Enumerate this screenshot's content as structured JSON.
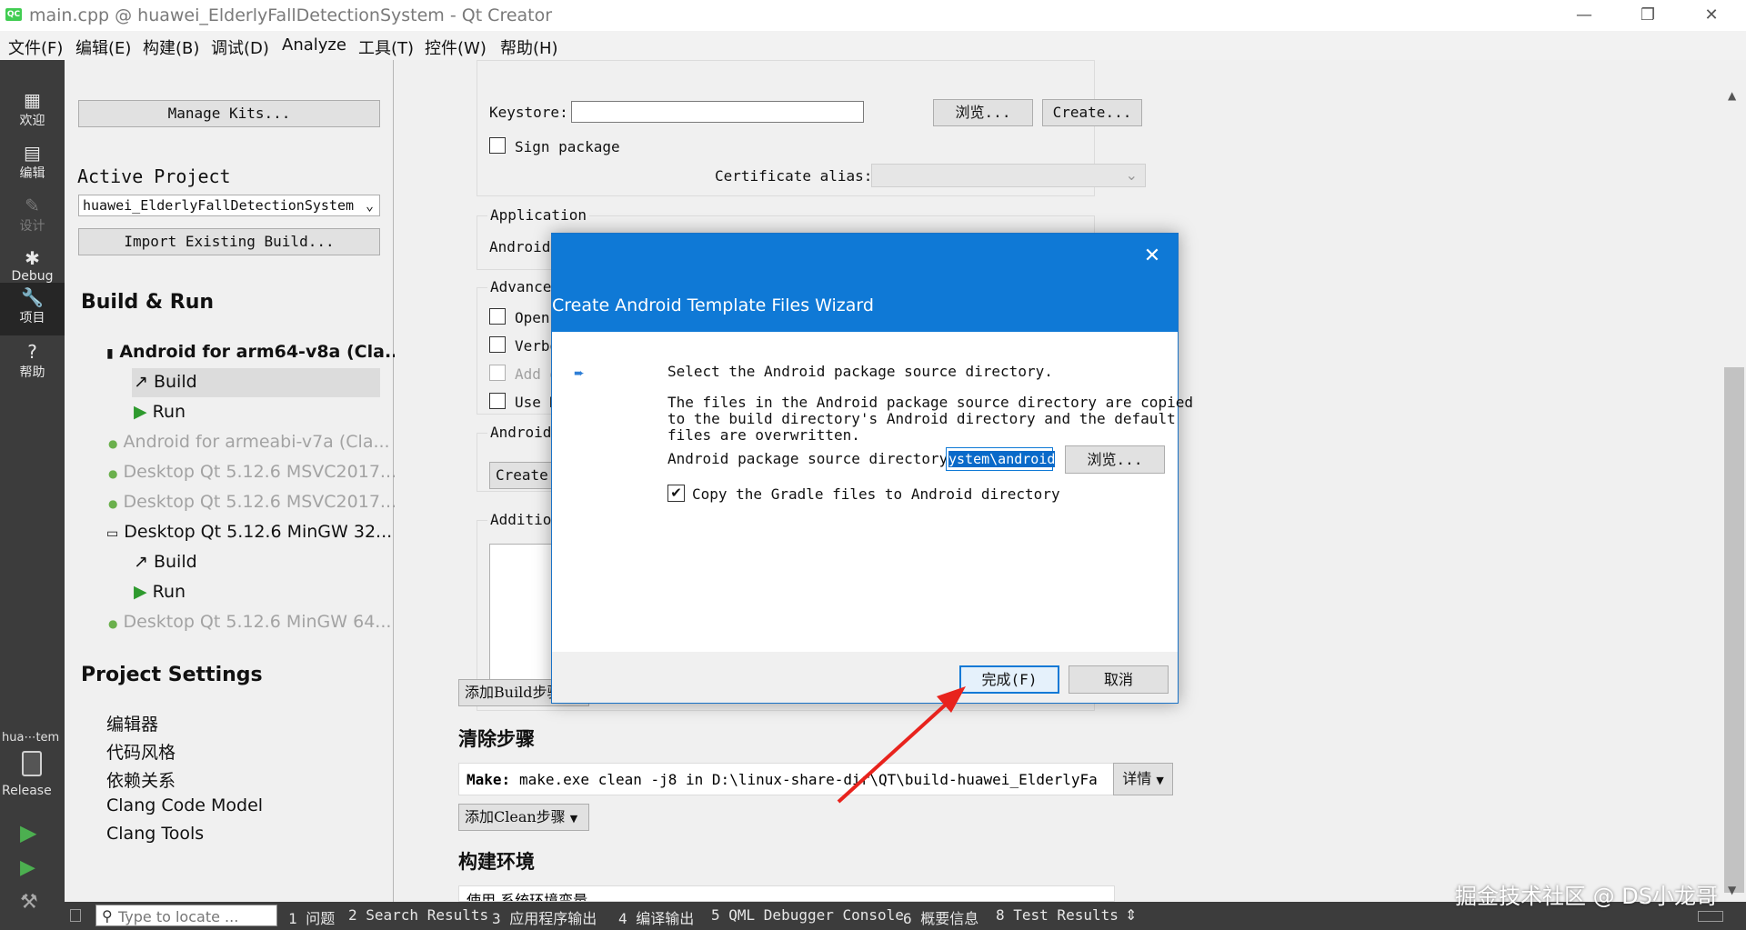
{
  "window": {
    "title": "main.cpp @ huawei_ElderlyFallDetectionSystem - Qt Creator",
    "app_icon_text": "QC",
    "minimize": "—",
    "restore": "❐",
    "close": "✕"
  },
  "menu": [
    "文件(F)",
    "编辑(E)",
    "构建(B)",
    "调试(D)",
    "Analyze",
    "工具(T)",
    "控件(W)",
    "帮助(H)"
  ],
  "modes": {
    "welcome": "欢迎",
    "edit": "编辑",
    "design": "设计",
    "debug": "Debug",
    "projects": "项目",
    "help": "帮助",
    "kit_project": "hua⋯tem",
    "kit_mode": "Release"
  },
  "nav": {
    "manage_kits": "Manage Kits...",
    "active_project_label": "Active Project",
    "active_project": "huawei_ElderlyFallDetectionSystem",
    "import_build": "Import Existing Build...",
    "build_run_heading": "Build & Run",
    "kits": [
      {
        "label": "Android for arm64-v8a (Cla...",
        "active": true
      },
      {
        "label": "Build",
        "sub": true,
        "selected": true
      },
      {
        "label": "Run",
        "sub": true
      },
      {
        "label": "Android for armeabi-v7a (Cla...",
        "dim": true
      },
      {
        "label": "Desktop Qt 5.12.6 MSVC2017...",
        "dim": true
      },
      {
        "label": "Desktop Qt 5.12.6 MSVC2017...",
        "dim": true
      },
      {
        "label": "Desktop Qt 5.12.6 MinGW 32...",
        "active": true
      },
      {
        "label": "Build",
        "sub": true
      },
      {
        "label": "Run",
        "sub": true
      },
      {
        "label": "Desktop Qt 5.12.6 MinGW 64...",
        "dim": true
      }
    ],
    "project_settings_heading": "Project Settings",
    "settings": [
      "编辑器",
      "代码风格",
      "依赖关系",
      "Clang Code Model",
      "Clang Tools"
    ]
  },
  "main": {
    "keystore_label": "Keystore:",
    "keystore_value": "",
    "browse": "浏览...",
    "create": "Create...",
    "sign_package": "Sign package",
    "certificate_alias": "Certificate alias:",
    "application_label": "Application",
    "android_short": "Android",
    "advanced_label": "Advanced",
    "adv_options": [
      "Open",
      "Verbo",
      "Add d",
      "Use M"
    ],
    "android_group": "Android",
    "create_short": "Create",
    "additional_label": "Addition",
    "add_build_step": "添加Build步骤",
    "clean_heading": "清除步骤",
    "make_label": "Make:",
    "make_value": "make.exe clean -j8 in D:\\linux-share-dir\\QT\\build-huawei_ElderlyFa",
    "details": "详情",
    "add_clean_step": "添加Clean步骤",
    "build_env_heading": "构建环境",
    "env_partial": "使用 系统环境变量"
  },
  "dialog": {
    "title": "Create Android Template Files Wizard",
    "close_icon": "✕",
    "step_text": "Select the Android package source directory.",
    "desc_line1": "The files in the Android package source directory are copied",
    "desc_line2": "to the build directory's Android directory and the default",
    "desc_line3": "files are overwritten.",
    "dir_label": "Android package source directory:",
    "dir_value": "ystem\\android",
    "browse": "浏览...",
    "copy_gradle": "Copy the Gradle files to Android directory",
    "finish": "完成(F)",
    "cancel": "取消"
  },
  "status": {
    "locate_placeholder": "Type to locate ...",
    "panes": [
      "1 问题",
      "2 Search Results",
      "3 应用程序输出",
      "4 编译输出",
      "5 QML Debugger Console",
      "6 概要信息",
      "8 Test Results"
    ],
    "arrows": "⇕"
  },
  "watermark": "掘金技术社区 @ DS小龙哥",
  "colors": {
    "accent": "#0f79d6",
    "annotation_arrow": "#e8231d"
  }
}
